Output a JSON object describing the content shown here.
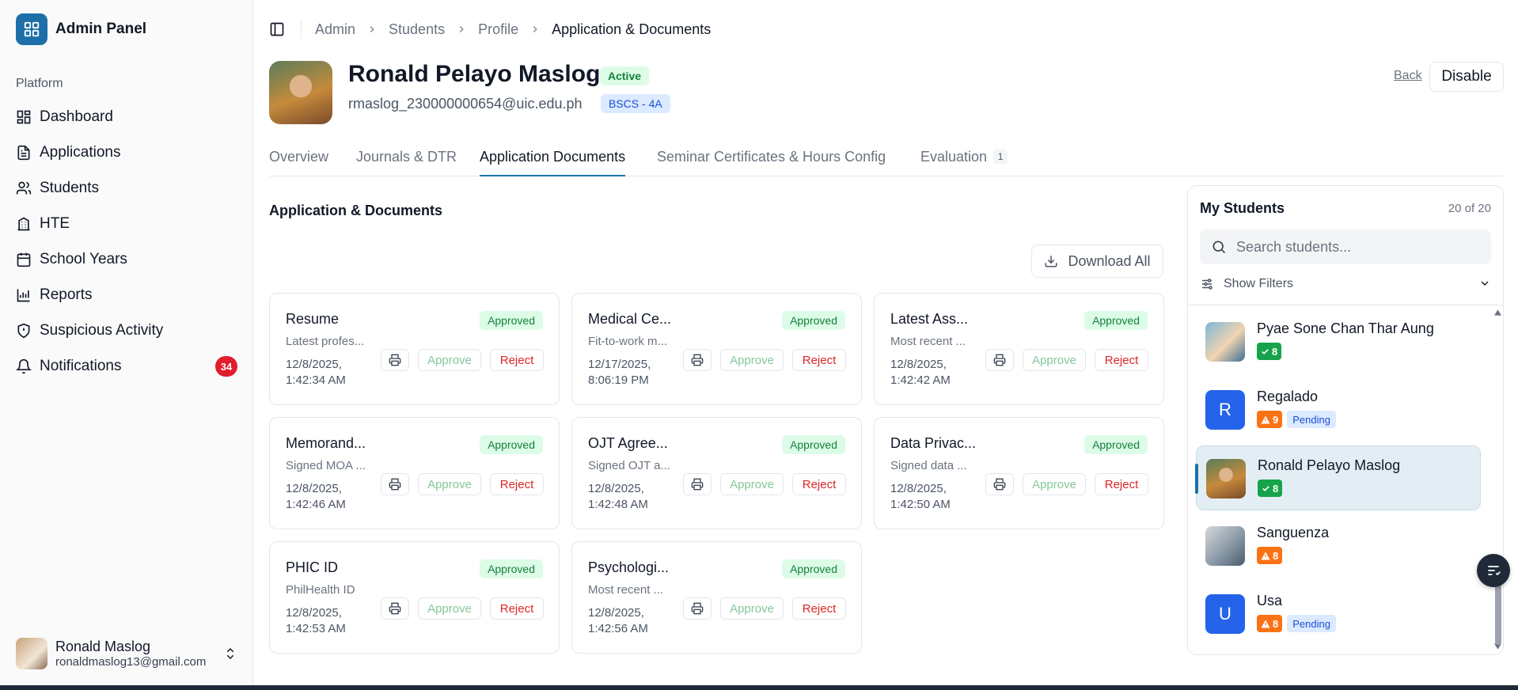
{
  "sidebar": {
    "app_title": "Admin Panel",
    "group_label": "Platform",
    "items": [
      {
        "label": "Dashboard",
        "icon": "dashboard-icon"
      },
      {
        "label": "Applications",
        "icon": "file-icon"
      },
      {
        "label": "Students",
        "icon": "users-icon"
      },
      {
        "label": "HTE",
        "icon": "building-icon"
      },
      {
        "label": "School Years",
        "icon": "calendar-icon"
      },
      {
        "label": "Reports",
        "icon": "bar-chart-icon"
      },
      {
        "label": "Suspicious Activity",
        "icon": "shield-icon"
      },
      {
        "label": "Notifications",
        "icon": "bell-icon",
        "badge": "34"
      }
    ],
    "user": {
      "name": "Ronald Maslog",
      "email": "ronaldmaslog13@gmail.com"
    }
  },
  "breadcrumb": [
    "Admin",
    "Students",
    "Profile",
    "Application & Documents"
  ],
  "profile": {
    "name": "Ronald Pelayo Maslog",
    "status": "Active",
    "email": "rmaslog_230000000654@uic.edu.ph",
    "section": "BSCS - 4A",
    "back_label": "Back",
    "disable_label": "Disable"
  },
  "tabs": [
    {
      "label": "Overview"
    },
    {
      "label": "Journals & DTR"
    },
    {
      "label": "Application Documents",
      "active": true
    },
    {
      "label": "Seminar Certificates & Hours Config"
    },
    {
      "label": "Evaluation",
      "count": "1"
    }
  ],
  "documents_section": {
    "title": "Application & Documents",
    "download_all_label": "Download All",
    "approve_label": "Approve",
    "reject_label": "Reject",
    "items": [
      {
        "title": "Resume",
        "desc": "Latest profes...",
        "date": "12/8/2025,",
        "time": "1:42:34 AM",
        "status": "Approved"
      },
      {
        "title": "Medical Ce...",
        "desc": "Fit-to-work m...",
        "date": "12/17/2025,",
        "time": "8:06:19 PM",
        "status": "Approved"
      },
      {
        "title": "Latest Ass...",
        "desc": "Most recent ...",
        "date": "12/8/2025,",
        "time": "1:42:42 AM",
        "status": "Approved"
      },
      {
        "title": "Memorand...",
        "desc": "Signed MOA ...",
        "date": "12/8/2025,",
        "time": "1:42:46 AM",
        "status": "Approved"
      },
      {
        "title": "OJT Agree...",
        "desc": "Signed OJT a...",
        "date": "12/8/2025,",
        "time": "1:42:48 AM",
        "status": "Approved"
      },
      {
        "title": "Data Privac...",
        "desc": "Signed data ...",
        "date": "12/8/2025,",
        "time": "1:42:50 AM",
        "status": "Approved"
      },
      {
        "title": "PHIC ID",
        "desc": "PhilHealth ID",
        "date": "12/8/2025,",
        "time": "1:42:53 AM",
        "status": "Approved"
      },
      {
        "title": "Psychologi...",
        "desc": "Most recent ...",
        "date": "12/8/2025,",
        "time": "1:42:56 AM",
        "status": "Approved"
      }
    ]
  },
  "my_students": {
    "title": "My Students",
    "count": "20 of 20",
    "search_placeholder": "Search students...",
    "filters_label": "Show Filters",
    "students": [
      {
        "name": "Pyae Sone Chan Thar Aung",
        "count": "8",
        "count_type": "ok",
        "avatar": "photo"
      },
      {
        "name": "Regalado",
        "count": "9",
        "count_type": "warn",
        "pending": "Pending",
        "initial": "R"
      },
      {
        "name": "Ronald Pelayo Maslog",
        "count": "8",
        "count_type": "ok",
        "avatar": "photo",
        "selected": true
      },
      {
        "name": "Sanguenza",
        "count": "8",
        "count_type": "warn",
        "avatar": "photo"
      },
      {
        "name": "Usa",
        "count": "8",
        "count_type": "warn",
        "pending": "Pending",
        "initial": "U"
      }
    ]
  },
  "colors": {
    "accent": "#1e6fa8",
    "approved_bg": "#dcfce7",
    "approved_text": "#15803d",
    "danger": "#dc2626",
    "warn": "#f97316",
    "ok": "#16a34a"
  }
}
